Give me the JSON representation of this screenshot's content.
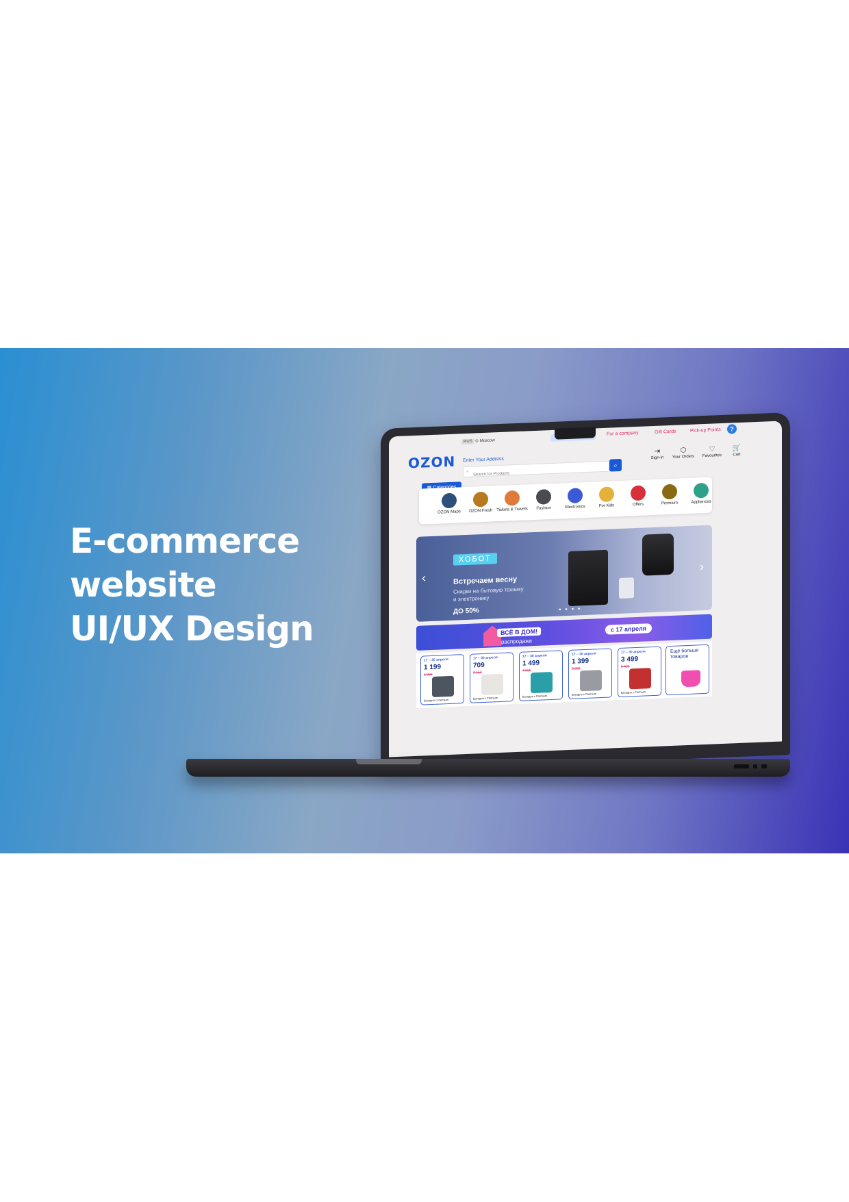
{
  "headline": [
    "E-commerce",
    "website",
    "UI/UX Design"
  ],
  "site": {
    "logo": "OZON",
    "lang": "RUS",
    "city": "Moscow",
    "address_label": "Enter Your Address",
    "top_links": {
      "seller": "Become a seller",
      "company": "For a company",
      "gift": "Gift Cards",
      "pickup": "Pick-up Points"
    },
    "help": "?",
    "search_placeholder": "Search for Products",
    "categories_button": "Categories",
    "account": [
      {
        "label": "Sign-in",
        "icon": "sign-in-icon",
        "glyph": "⇥"
      },
      {
        "label": "Your Orders",
        "icon": "box-icon",
        "glyph": "⬡"
      },
      {
        "label": "Favourites",
        "icon": "heart-icon",
        "glyph": "♡"
      },
      {
        "label": "Cart",
        "icon": "cart-icon",
        "glyph": "🛒"
      }
    ],
    "categories": [
      {
        "label": "OZON Maps",
        "color": "#2c4f7c"
      },
      {
        "label": "OZON Fresh",
        "color": "#b87a1e"
      },
      {
        "label": "Tickets & Travels",
        "color": "#e07a3a"
      },
      {
        "label": "Fashion",
        "color": "#4a4a52"
      },
      {
        "label": "Electronics",
        "color": "#3b5bd6"
      },
      {
        "label": "For Kids",
        "color": "#e4b23a"
      },
      {
        "label": "Offers",
        "color": "#d8303a"
      },
      {
        "label": "Premium",
        "color": "#8a6a10"
      },
      {
        "label": "Appliances",
        "color": "#2fa08a"
      }
    ]
  },
  "hero": {
    "brand": "ХОБОТ",
    "title": "Встречаем весну",
    "sub1": "Скидки на бытовую технику",
    "sub2": "и электронику",
    "discount": "ДО 50%"
  },
  "promo": {
    "badge": "ВСЁ В ДОМ!",
    "sale": "распродажа",
    "date": "с 17 апреля"
  },
  "cards": [
    {
      "date": "17 – 30 апреля",
      "price": "1 199",
      "old": "1 999",
      "footer": "Выгодно с Premium",
      "color": "#4d5560"
    },
    {
      "date": "17 – 30 апреля",
      "price": "709",
      "old": "2 150",
      "footer": "Выгодно с Premium",
      "color": "#e8e6e2"
    },
    {
      "date": "17 – 30 апреля",
      "price": "1 499",
      "old": "4 099",
      "footer": "Выгодно с Premium",
      "color": "#2a9fa8"
    },
    {
      "date": "17 – 30 апреля",
      "price": "1 399",
      "old": "2 999",
      "footer": "Выгодно с Premium",
      "color": "#9a9aa2"
    },
    {
      "date": "17 – 30 апреля",
      "price": "3 499",
      "old": "5 499",
      "footer": "Выгодно с Premium",
      "color": "#c23030"
    }
  ],
  "more": {
    "label": "Ещё больше товаров"
  }
}
